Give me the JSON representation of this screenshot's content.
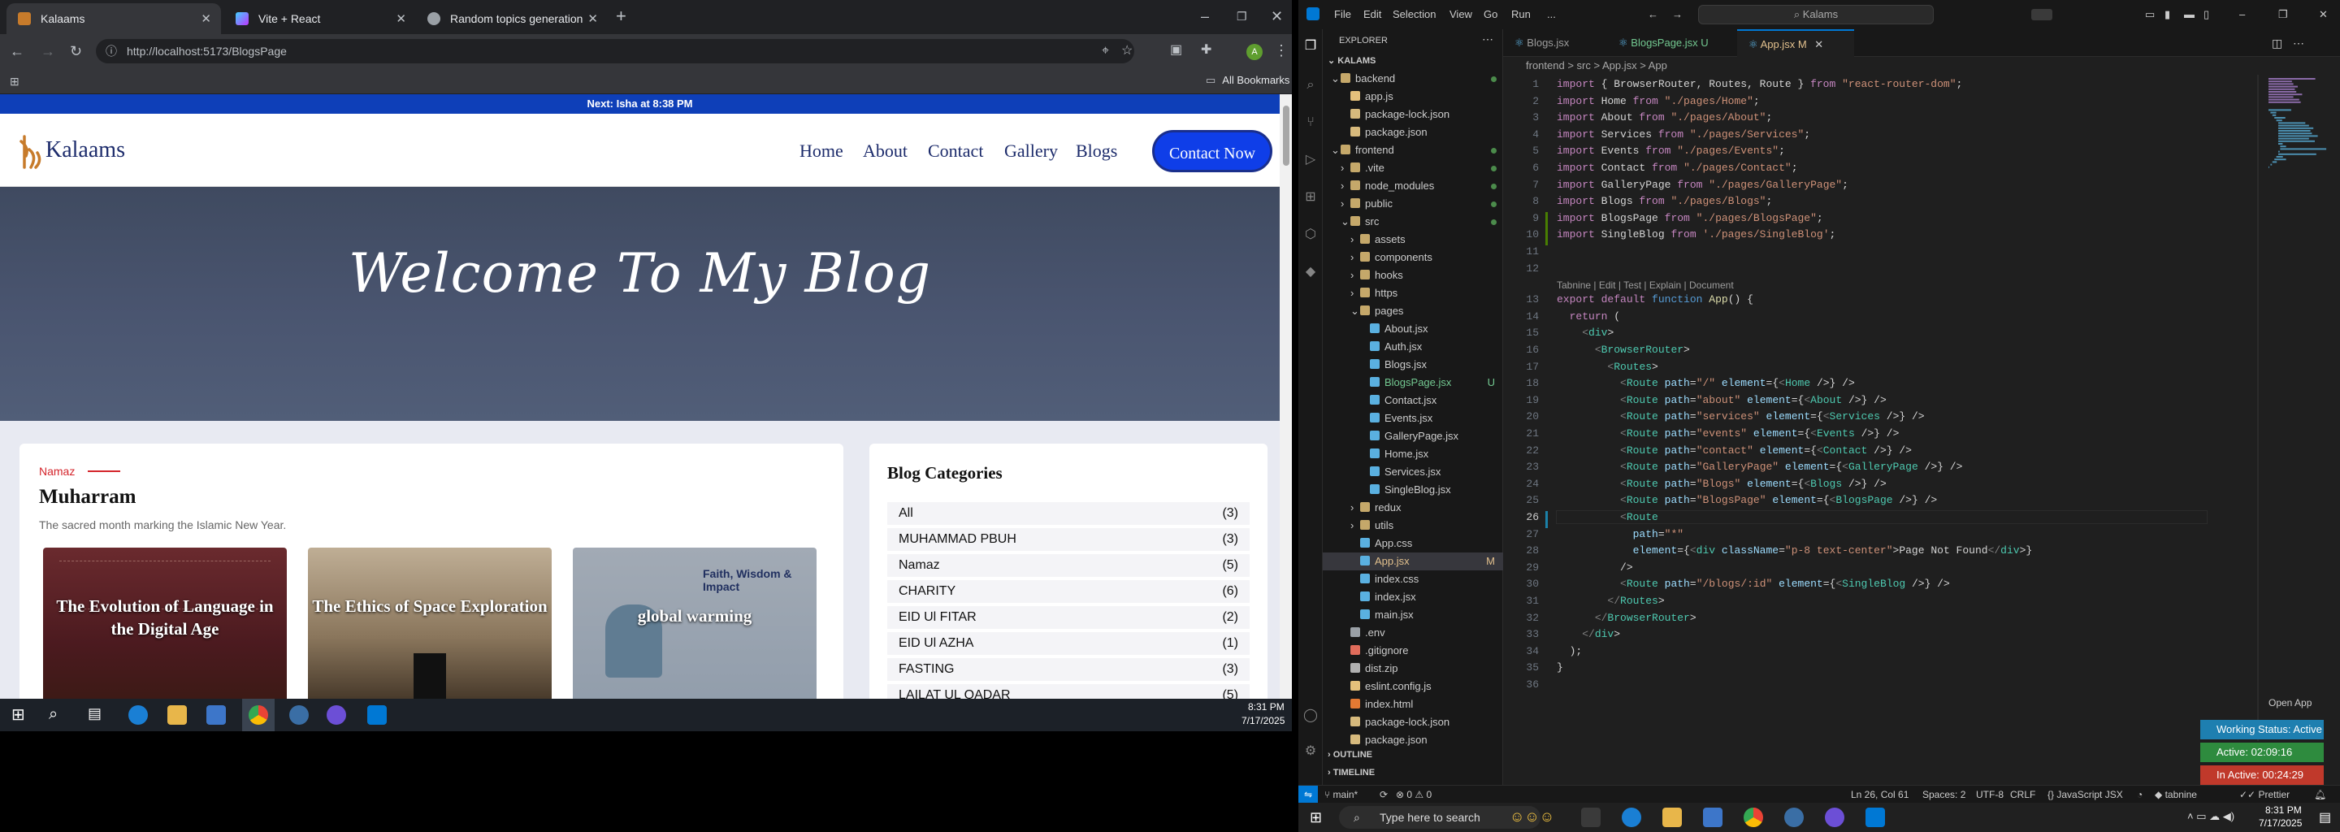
{
  "browser": {
    "tabs": [
      {
        "title": "Kalaams",
        "active": true
      },
      {
        "title": "Vite + React",
        "active": false
      },
      {
        "title": "Random topics generation",
        "active": false
      }
    ],
    "url": "http://localhost:5173/BlogsPage",
    "bookmarks_label": "All Bookmarks"
  },
  "site": {
    "announcement": "Next: Isha at 8:38 PM",
    "logo_text": "Kalaams",
    "nav": [
      "Home",
      "About",
      "Contact",
      "Gallery",
      "Blogs"
    ],
    "cta": "Contact Now",
    "hero_title": "Welcome To My Blog",
    "post": {
      "category": "Namaz",
      "title": "Muharram",
      "subtitle": "The sacred month marking the Islamic New Year."
    },
    "cards": [
      {
        "title": "The Evolution of Language in the Digital Age"
      },
      {
        "title": "The Ethics of Space Exploration"
      },
      {
        "title": "global warming",
        "overlay_heading": "Faith, Wisdom & Impact"
      }
    ],
    "categories_title": "Blog Categories",
    "categories": [
      {
        "name": "All",
        "count": "(3)"
      },
      {
        "name": "MUHAMMAD PBUH",
        "count": "(3)"
      },
      {
        "name": "Namaz",
        "count": "(5)"
      },
      {
        "name": "CHARITY",
        "count": "(6)"
      },
      {
        "name": "EID Ul FITAR",
        "count": "(2)"
      },
      {
        "name": "EID Ul AZHA",
        "count": "(1)"
      },
      {
        "name": "FASTING",
        "count": "(3)"
      },
      {
        "name": "LAILAT UL QADAR",
        "count": "(5)"
      }
    ]
  },
  "left_taskbar": {
    "time": "8:31 PM",
    "date": "7/17/2025"
  },
  "vscode": {
    "menu": [
      "File",
      "Edit",
      "Selection",
      "View",
      "Go",
      "Run",
      "..."
    ],
    "search": "Kalams",
    "explorer_title": "EXPLORER",
    "workspace": "KALAMS",
    "tree": [
      {
        "name": "backend",
        "type": "folder",
        "depth": 0,
        "open": true
      },
      {
        "name": "app.js",
        "type": "js",
        "depth": 1
      },
      {
        "name": "package-lock.json",
        "type": "json",
        "depth": 1
      },
      {
        "name": "package.json",
        "type": "json",
        "depth": 1
      },
      {
        "name": "frontend",
        "type": "folder",
        "depth": 0,
        "open": true
      },
      {
        "name": ".vite",
        "type": "folder",
        "depth": 1
      },
      {
        "name": "node_modules",
        "type": "folder",
        "depth": 1
      },
      {
        "name": "public",
        "type": "folder",
        "depth": 1
      },
      {
        "name": "src",
        "type": "folder",
        "depth": 1,
        "open": true
      },
      {
        "name": "assets",
        "type": "folder",
        "depth": 2
      },
      {
        "name": "components",
        "type": "folder",
        "depth": 2
      },
      {
        "name": "hooks",
        "type": "folder",
        "depth": 2
      },
      {
        "name": "https",
        "type": "folder",
        "depth": 2
      },
      {
        "name": "pages",
        "type": "folder",
        "depth": 2,
        "open": true
      },
      {
        "name": "About.jsx",
        "type": "jsx",
        "depth": 3
      },
      {
        "name": "Auth.jsx",
        "type": "jsx",
        "depth": 3
      },
      {
        "name": "Blogs.jsx",
        "type": "jsx",
        "depth": 3
      },
      {
        "name": "BlogsPage.jsx",
        "type": "jsx",
        "depth": 3,
        "badge": "U"
      },
      {
        "name": "Contact.jsx",
        "type": "jsx",
        "depth": 3
      },
      {
        "name": "Events.jsx",
        "type": "jsx",
        "depth": 3
      },
      {
        "name": "GalleryPage.jsx",
        "type": "jsx",
        "depth": 3
      },
      {
        "name": "Home.jsx",
        "type": "jsx",
        "depth": 3
      },
      {
        "name": "Services.jsx",
        "type": "jsx",
        "depth": 3
      },
      {
        "name": "SingleBlog.jsx",
        "type": "jsx",
        "depth": 3
      },
      {
        "name": "redux",
        "type": "folder",
        "depth": 2
      },
      {
        "name": "utils",
        "type": "folder",
        "depth": 2
      },
      {
        "name": "App.css",
        "type": "css",
        "depth": 2
      },
      {
        "name": "App.jsx",
        "type": "jsx",
        "depth": 2,
        "badge": "M",
        "selected": true
      },
      {
        "name": "index.css",
        "type": "css",
        "depth": 2
      },
      {
        "name": "index.jsx",
        "type": "jsx",
        "depth": 2
      },
      {
        "name": "main.jsx",
        "type": "jsx",
        "depth": 2
      },
      {
        "name": ".env",
        "type": "env",
        "depth": 1
      },
      {
        "name": ".gitignore",
        "type": "git",
        "depth": 1
      },
      {
        "name": "dist.zip",
        "type": "zip",
        "depth": 1
      },
      {
        "name": "eslint.config.js",
        "type": "js",
        "depth": 1
      },
      {
        "name": "index.html",
        "type": "html",
        "depth": 1
      },
      {
        "name": "package-lock.json",
        "type": "json",
        "depth": 1
      },
      {
        "name": "package.json",
        "type": "json",
        "depth": 1
      }
    ],
    "outline": "OUTLINE",
    "timeline": "TIMELINE",
    "tabs": [
      {
        "name": "Blogs.jsx",
        "active": false
      },
      {
        "name": "BlogsPage.jsx",
        "badge": "U",
        "active": false
      },
      {
        "name": "App.jsx",
        "badge": "M",
        "active": true
      }
    ],
    "breadcrumb": "frontend > src > App.jsx > App",
    "codelens": "Tabnine | Edit | Test | Explain | Document",
    "code_lines": [
      "import { BrowserRouter, Routes, Route } from \"react-router-dom\";",
      "import Home from \"./pages/Home\";",
      "import About from \"./pages/About\";",
      "import Services from \"./pages/Services\";",
      "import Events from \"./pages/Events\";",
      "import Contact from \"./pages/Contact\";",
      "import GalleryPage from \"./pages/GalleryPage\";",
      "import Blogs from \"./pages/Blogs\";",
      "import BlogsPage from \"./pages/BlogsPage\";",
      "import SingleBlog from './pages/SingleBlog';",
      "",
      "",
      "export default function App() {",
      "  return (",
      "    <div>",
      "      <BrowserRouter>",
      "        <Routes>",
      "          <Route path=\"/\" element={<Home />} />",
      "          <Route path=\"about\" element={<About />} />",
      "          <Route path=\"services\" element={<Services />} />",
      "          <Route path=\"events\" element={<Events />} />",
      "          <Route path=\"contact\" element={<Contact />} />",
      "          <Route path=\"GalleryPage\" element={<GalleryPage />} />",
      "          <Route path=\"Blogs\" element={<Blogs />} />",
      "          <Route path=\"BlogsPage\" element={<BlogsPage />} />",
      "          <Route",
      "            path=\"*\"",
      "            element={<div className=\"p-8 text-center\">Page Not Found</div>}",
      "          />",
      "          <Route path=\"/blogs/:id\" element={<SingleBlog />} />",
      "        </Routes>",
      "      </BrowserRouter>",
      "    </div>",
      "  );",
      "}",
      ""
    ],
    "status": {
      "branch": "main*",
      "problems": "⊗ 0 ⚠ 0",
      "position": "Ln 26, Col 61",
      "spaces": "Spaces: 2",
      "encoding": "UTF-8",
      "eol": "CRLF",
      "language": "{} JavaScript JSX",
      "tabnine": "tabnine",
      "prettier": "Prettier"
    },
    "open_app": "Open App",
    "working_status": [
      {
        "label": "Working Status: Active",
        "color": "#1e7fb0"
      },
      {
        "label": "Active: 02:09:16",
        "color": "#2e8b3e"
      },
      {
        "label": "In Active: 00:24:29",
        "color": "#c0392b"
      }
    ]
  },
  "right_taskbar": {
    "search_placeholder": "Type here to search",
    "time": "8:31 PM",
    "date": "7/17/2025"
  }
}
